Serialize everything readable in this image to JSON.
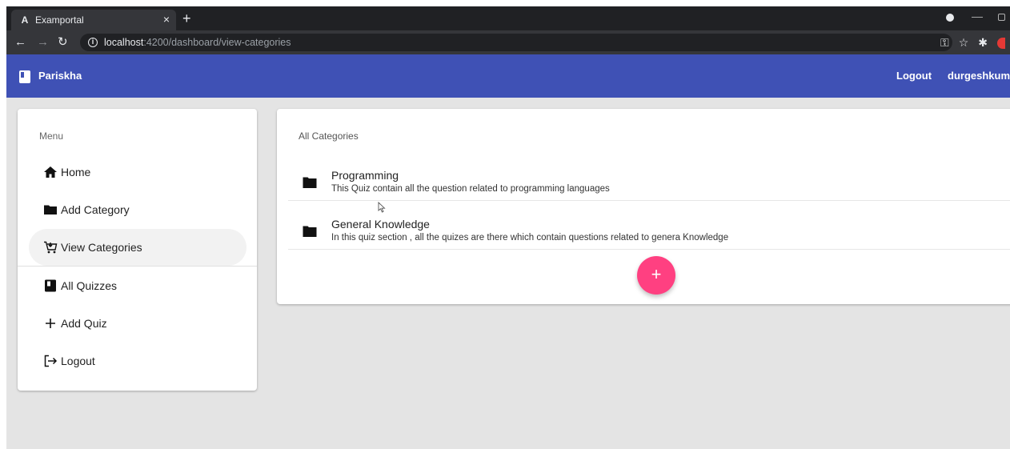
{
  "browser": {
    "tab_title": "Examportal",
    "tab_favicon": "A",
    "close_glyph": "×",
    "new_tab_glyph": "+",
    "url_host": "localhost",
    "url_path": ":4200/dashboard/view-categories"
  },
  "toolbar": {
    "brand": "Pariskha",
    "logout_label": "Logout",
    "user_label": "durgeshkuma",
    "color": "#3f51b5"
  },
  "sidebar": {
    "heading": "Menu",
    "items": [
      {
        "label": "Home",
        "icon": "home-icon"
      },
      {
        "label": "Add Category",
        "icon": "folder-icon"
      },
      {
        "label": "View Categories",
        "icon": "cart-icon",
        "active": true
      },
      {
        "label": "All Quizzes",
        "icon": "book-icon"
      },
      {
        "label": "Add Quiz",
        "icon": "plus-icon"
      },
      {
        "label": "Logout",
        "icon": "logout-icon"
      }
    ]
  },
  "main": {
    "title": "All Categories",
    "categories": [
      {
        "name": "Programming",
        "description": "This Quiz contain all the question related to programming languages"
      },
      {
        "name": "General Knowledge",
        "description": "In this quiz section , all the quizes are there which contain questions related to genera Knowledge"
      }
    ],
    "fab_label": "+",
    "fab_color": "#ff4081"
  }
}
